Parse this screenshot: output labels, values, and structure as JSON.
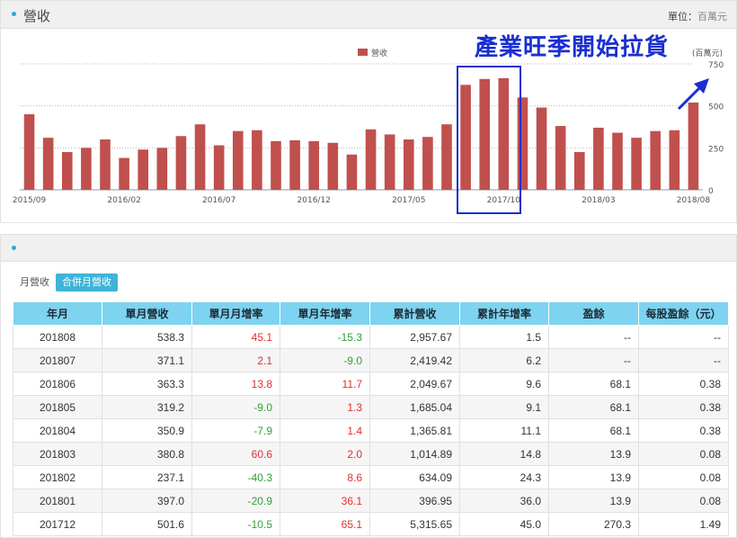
{
  "chart_panel": {
    "title": "營收",
    "unit_label": "單位：",
    "unit_value": "百萬元"
  },
  "annotation": {
    "text": "產業旺季開始拉貨",
    "color": "#1a2fd0"
  },
  "chart_data": {
    "type": "bar",
    "title": "",
    "legend": "營收",
    "legend_position": "top-center",
    "bar_color": "#c0504d",
    "y_axis_label": "(百萬元)",
    "y_axis_position": "right",
    "ylim": [
      0,
      750
    ],
    "y_ticks": [
      0,
      250,
      500,
      750
    ],
    "grid": true,
    "x_tick_labels": [
      "2015/09",
      "2016/02",
      "2016/07",
      "2016/12",
      "2017/05",
      "2017/10",
      "2018/03",
      "2018/08"
    ],
    "categories": [
      "2015/09",
      "2015/10",
      "2015/11",
      "2015/12",
      "2016/01",
      "2016/02",
      "2016/03",
      "2016/04",
      "2016/05",
      "2016/06",
      "2016/07",
      "2016/08",
      "2016/09",
      "2016/10",
      "2016/11",
      "2016/12",
      "2017/01",
      "2017/02",
      "2017/03",
      "2017/04",
      "2017/05",
      "2017/06",
      "2017/07",
      "2017/08",
      "2017/09",
      "2017/10",
      "2017/11",
      "2017/12",
      "2018/01",
      "2018/02",
      "2018/03",
      "2018/04",
      "2018/05",
      "2018/06",
      "2018/07",
      "2018/08"
    ],
    "values": [
      450,
      310,
      225,
      250,
      300,
      190,
      240,
      250,
      320,
      390,
      265,
      350,
      355,
      290,
      295,
      290,
      280,
      210,
      360,
      330,
      300,
      315,
      390,
      625,
      660,
      665,
      550,
      490,
      380,
      225,
      370,
      340,
      310,
      350,
      355,
      520
    ]
  },
  "list_panel": {
    "title": ""
  },
  "tabs": [
    {
      "label": "月營收"
    },
    {
      "label": "合併月營收"
    }
  ],
  "table": {
    "headers": [
      "年月",
      "單月營收",
      "單月月增率",
      "單月年增率",
      "累計營收",
      "累計年增率",
      "盈餘",
      "每股盈餘（元）"
    ],
    "rows": [
      [
        "201808",
        "538.3",
        "45.1",
        "-15.3",
        "2,957.67",
        "1.5",
        "--",
        "--"
      ],
      [
        "201807",
        "371.1",
        "2.1",
        "-9.0",
        "2,419.42",
        "6.2",
        "--",
        "--"
      ],
      [
        "201806",
        "363.3",
        "13.8",
        "11.7",
        "2,049.67",
        "9.6",
        "68.1",
        "0.38"
      ],
      [
        "201805",
        "319.2",
        "-9.0",
        "1.3",
        "1,685.04",
        "9.1",
        "68.1",
        "0.38"
      ],
      [
        "201804",
        "350.9",
        "-7.9",
        "1.4",
        "1,365.81",
        "11.1",
        "68.1",
        "0.38"
      ],
      [
        "201803",
        "380.8",
        "60.6",
        "2.0",
        "1,014.89",
        "14.8",
        "13.9",
        "0.08"
      ],
      [
        "201802",
        "237.1",
        "-40.3",
        "8.6",
        "634.09",
        "24.3",
        "13.9",
        "0.08"
      ],
      [
        "201801",
        "397.0",
        "-20.9",
        "36.1",
        "396.95",
        "36.0",
        "13.9",
        "0.08"
      ],
      [
        "201712",
        "501.6",
        "-10.5",
        "65.1",
        "5,315.65",
        "45.0",
        "270.3",
        "1.49"
      ]
    ]
  }
}
